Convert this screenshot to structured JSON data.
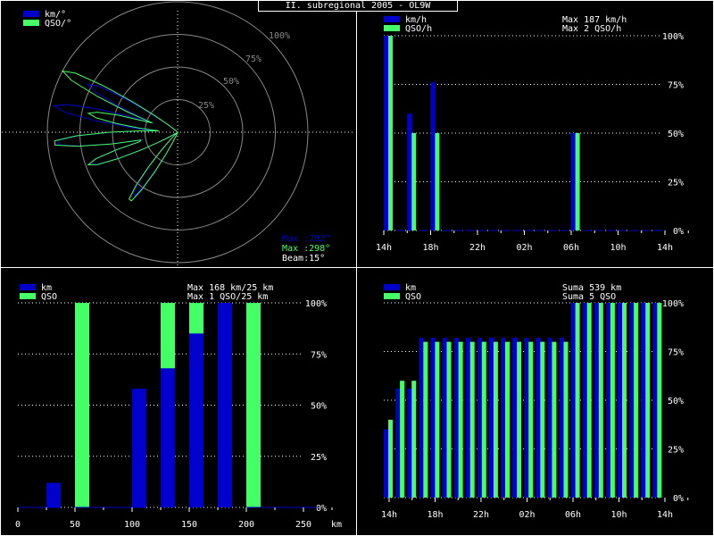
{
  "title": "II. subregional 2005 - OL9W",
  "colors": {
    "km": "#0000cc",
    "qso": "#44ff66",
    "grid": "#ffffff",
    "text": "#ffffff",
    "ring": "#888888"
  },
  "polar": {
    "legend": [
      "km/°",
      "QSO/°"
    ],
    "ring_labels": [
      "25%",
      "50%",
      "75%",
      "100%"
    ],
    "info": {
      "max_km": "Max :282°",
      "max_qso": "Max :298°",
      "beam": "Beam:15°"
    }
  },
  "chart_data": [
    {
      "type": "polar",
      "unit": "degrees",
      "series": [
        {
          "name": "km/°",
          "lobes": [
            {
              "azimuth": 298,
              "value": 0.78
            },
            {
              "azimuth": 282,
              "value": 0.97
            },
            {
              "azimuth": 265,
              "value": 0.95
            },
            {
              "azimuth": 250,
              "value": 0.72
            },
            {
              "azimuth": 215,
              "value": 0.6
            }
          ]
        },
        {
          "name": "QSO/°",
          "lobes": [
            {
              "azimuth": 298,
              "value": 1.0
            },
            {
              "azimuth": 282,
              "value": 0.7
            },
            {
              "azimuth": 265,
              "value": 0.97
            },
            {
              "azimuth": 250,
              "value": 0.73
            },
            {
              "azimuth": 215,
              "value": 0.65
            }
          ]
        }
      ]
    },
    {
      "type": "bar",
      "legend": [
        "km/h",
        "QSO/h"
      ],
      "info": [
        "Max   187 km/h",
        "Max    2 QSO/h"
      ],
      "y_ticks": [
        "0%",
        "25%",
        "50%",
        "75%",
        "100%"
      ],
      "x_ticks": [
        "14h",
        "18h",
        "22h",
        "02h",
        "06h",
        "10h",
        "14h"
      ],
      "categories": [
        "14",
        "15",
        "16",
        "17",
        "18",
        "19",
        "20",
        "21",
        "22",
        "23",
        "00",
        "01",
        "02",
        "03",
        "04",
        "05",
        "06",
        "07",
        "08",
        "09",
        "10",
        "11",
        "12",
        "13"
      ],
      "series": [
        {
          "name": "km/h",
          "values": [
            100,
            0,
            60,
            0,
            76,
            0,
            0,
            0,
            0,
            0,
            0,
            0,
            0,
            0,
            0,
            0,
            50,
            0,
            0,
            0,
            0,
            0,
            0,
            0
          ]
        },
        {
          "name": "QSO/h",
          "values": [
            100,
            0,
            50,
            0,
            50,
            0,
            0,
            0,
            0,
            0,
            0,
            0,
            0,
            0,
            0,
            0,
            50,
            0,
            0,
            0,
            0,
            0,
            0,
            0
          ]
        }
      ],
      "ylim": [
        0,
        100
      ]
    },
    {
      "type": "bar",
      "legend": [
        "km",
        "QSO"
      ],
      "info": [
        "Max   168 km/25 km",
        "Max    1 QSO/25 km"
      ],
      "y_ticks": [
        "0%",
        "25%",
        "50%",
        "75%",
        "100%"
      ],
      "x_ticks": [
        "0",
        "50",
        "100",
        "150",
        "200",
        "250"
      ],
      "xlabel": "km",
      "categories": [
        "0",
        "12.5",
        "25",
        "37.5",
        "50",
        "62.5",
        "75",
        "87.5",
        "100",
        "112.5",
        "125",
        "137.5",
        "150",
        "162.5",
        "175",
        "187.5",
        "200",
        "212.5",
        "225",
        "237.5"
      ],
      "series": [
        {
          "name": "km",
          "values": [
            0,
            0,
            12,
            0,
            0,
            0,
            0,
            0,
            58,
            0,
            68,
            0,
            85,
            0,
            100,
            0,
            0,
            0,
            0,
            0
          ]
        },
        {
          "name": "QSO",
          "values": [
            0,
            0,
            0,
            100,
            0,
            0,
            0,
            0,
            0,
            100,
            0,
            100,
            0,
            100,
            0,
            100,
            0,
            0,
            0,
            0
          ]
        }
      ],
      "ylim": [
        0,
        100
      ]
    },
    {
      "type": "bar",
      "legend": [
        "km",
        "QSO"
      ],
      "info": [
        "Suma    539 km",
        "Suma     5 QSO"
      ],
      "y_ticks": [
        "0%",
        "25%",
        "50%",
        "75%",
        "100%"
      ],
      "x_ticks": [
        "14h",
        "18h",
        "22h",
        "02h",
        "06h",
        "10h",
        "14h"
      ],
      "categories": [
        "14",
        "15",
        "16",
        "17",
        "18",
        "19",
        "20",
        "21",
        "22",
        "23",
        "00",
        "01",
        "02",
        "03",
        "04",
        "05",
        "06",
        "07",
        "08",
        "09",
        "10",
        "11",
        "12",
        "13"
      ],
      "series": [
        {
          "name": "km",
          "values": [
            35,
            56,
            56,
            82,
            82,
            82,
            82,
            82,
            82,
            82,
            82,
            82,
            82,
            82,
            82,
            82,
            100,
            100,
            100,
            100,
            100,
            100,
            100,
            100
          ]
        },
        {
          "name": "QSO",
          "values": [
            40,
            60,
            60,
            80,
            80,
            80,
            80,
            80,
            80,
            80,
            80,
            80,
            80,
            80,
            80,
            80,
            100,
            100,
            100,
            100,
            100,
            100,
            100,
            100
          ]
        }
      ],
      "ylim": [
        0,
        100
      ]
    }
  ]
}
